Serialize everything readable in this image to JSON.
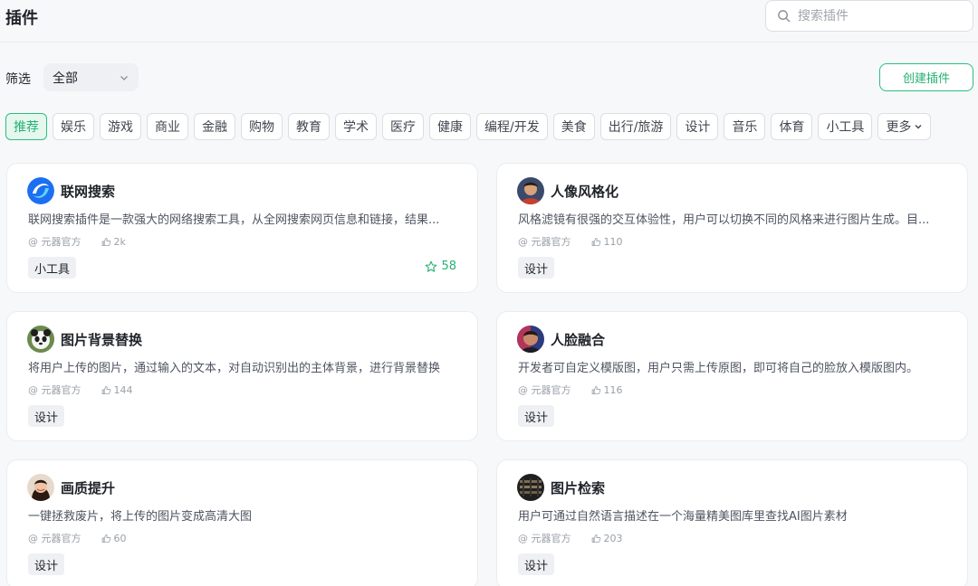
{
  "header": {
    "title": "插件",
    "search": {
      "placeholder": "搜索插件",
      "value": ""
    }
  },
  "filter": {
    "label": "筛选",
    "selected": "全部",
    "create_label": "创建插件"
  },
  "categories": [
    "推荐",
    "娱乐",
    "游戏",
    "商业",
    "金融",
    "购物",
    "教育",
    "学术",
    "医疗",
    "健康",
    "编程/开发",
    "美食",
    "出行/旅游",
    "设计",
    "音乐",
    "体育",
    "小工具"
  ],
  "categories_more": "更多",
  "active_category": "推荐",
  "plugins": [
    {
      "name": "联网搜索",
      "desc": "联网搜索插件是一款强大的网络搜索工具，从全网搜索网页信息和链接，结果...",
      "author": "@ 元器官方",
      "likes": "2k",
      "tag": "小工具",
      "stars": "58",
      "icon": "globe-swirl-icon"
    },
    {
      "name": "人像风格化",
      "desc": "风格滤镜有很强的交互体验性，用户可以切换不同的风格来进行图片生成。目...",
      "author": "@ 元器官方",
      "likes": "110",
      "tag": "设计",
      "icon": "portrait-icon"
    },
    {
      "name": "图片背景替换",
      "desc": "将用户上传的图片，通过输入的文本，对自动识别出的主体背景，进行背景替换",
      "author": "@ 元器官方",
      "likes": "144",
      "tag": "设计",
      "icon": "panda-icon"
    },
    {
      "name": "人脸融合",
      "desc": "开发者可自定义模版图，用户只需上传原图，即可将自己的脸放入模版图内。",
      "author": "@ 元器官方",
      "likes": "116",
      "tag": "设计",
      "icon": "face-icon"
    },
    {
      "name": "画质提升",
      "desc": "一键拯救废片，将上传的图片变成高清大图",
      "author": "@ 元器官方",
      "likes": "60",
      "tag": "设计",
      "icon": "portrait-girl-icon"
    },
    {
      "name": "图片检索",
      "desc": "用户可通过自然语言描述在一个海量精美图库里查找AI图片素材",
      "author": "@ 元器官方",
      "likes": "203",
      "tag": "设计",
      "icon": "gallery-icon"
    }
  ],
  "colors": {
    "accent": "#25b172",
    "accent_bg": "#e5f7ee",
    "page_bg": "#f7f8fa"
  }
}
